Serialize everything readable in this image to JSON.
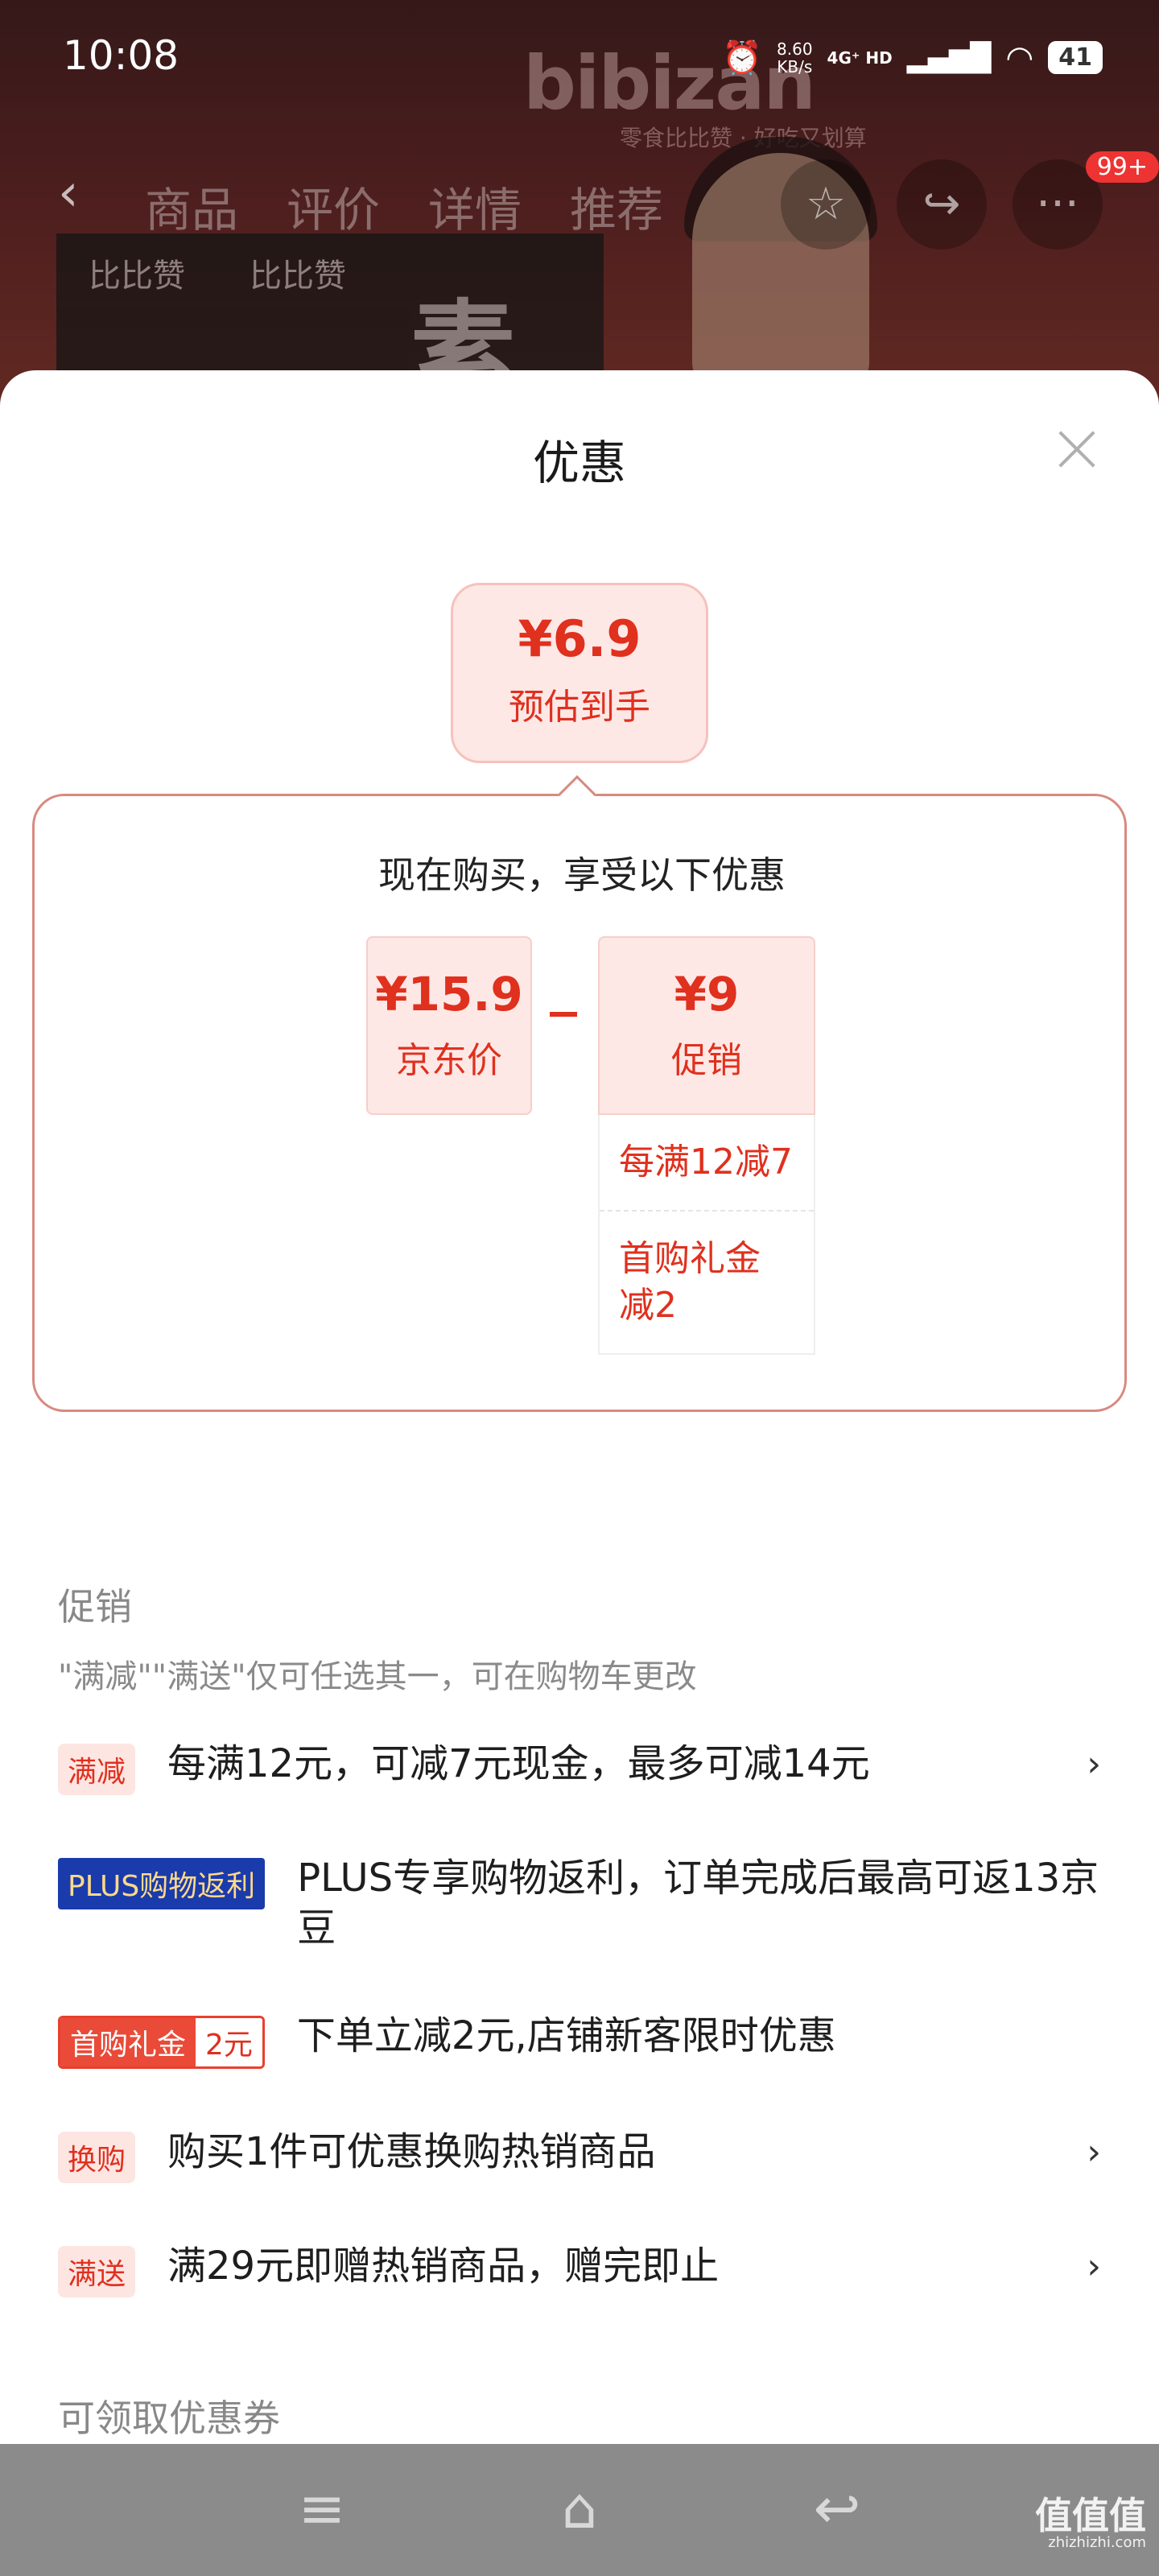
{
  "status_bar": {
    "time": "10:08",
    "net_speed_value": "8.60",
    "net_speed_unit": "KB/s",
    "net_type": "4G⁺ HD",
    "battery": "41"
  },
  "background": {
    "brand": "bibizan",
    "slogan": "零食比比赞 · 好吃又划算",
    "pack_label": "比比赞",
    "pack_big_text": "素大"
  },
  "top_nav": {
    "tabs": [
      "商品",
      "评价",
      "详情",
      "推荐"
    ],
    "badge": "99+"
  },
  "sheet": {
    "title": "优惠",
    "estimate": {
      "price": "¥6.9",
      "label": "预估到手"
    },
    "calc": {
      "heading": "现在购买，享受以下优惠",
      "jd_price": {
        "value": "¥15.9",
        "label": "京东价"
      },
      "promo": {
        "value": "¥9",
        "label": "促销"
      },
      "promo_details": [
        "每满12减7",
        "首购礼金减2"
      ]
    },
    "promotions_title": "促销",
    "promotions_note": "\"满减\"\"满送\"仅可任选其一，可在购物车更改",
    "promotions": [
      {
        "tag": "满减",
        "text": "每满12元，可减7元现金，最多可减14元"
      },
      {
        "tag": "PLUS购物返利",
        "text": "PLUS专享购物返利，订单完成后最高可返13京豆"
      },
      {
        "tag": "首购礼金",
        "tag_amount": "2元",
        "text": "下单立减2元,店铺新客限时优惠"
      },
      {
        "tag": "换购",
        "text": "购买1件可优惠换购热销商品"
      },
      {
        "tag": "满送",
        "text": "满29元即赠热销商品，赠完即止"
      }
    ],
    "coupons_title": "可领取优惠券"
  },
  "watermark": {
    "main": "值值值",
    "sub": "zhizhizhi.com"
  },
  "colors": {
    "accent": "#e0301e",
    "tag_bg": "#fde5e2",
    "plus_bg": "#1a3bab"
  }
}
